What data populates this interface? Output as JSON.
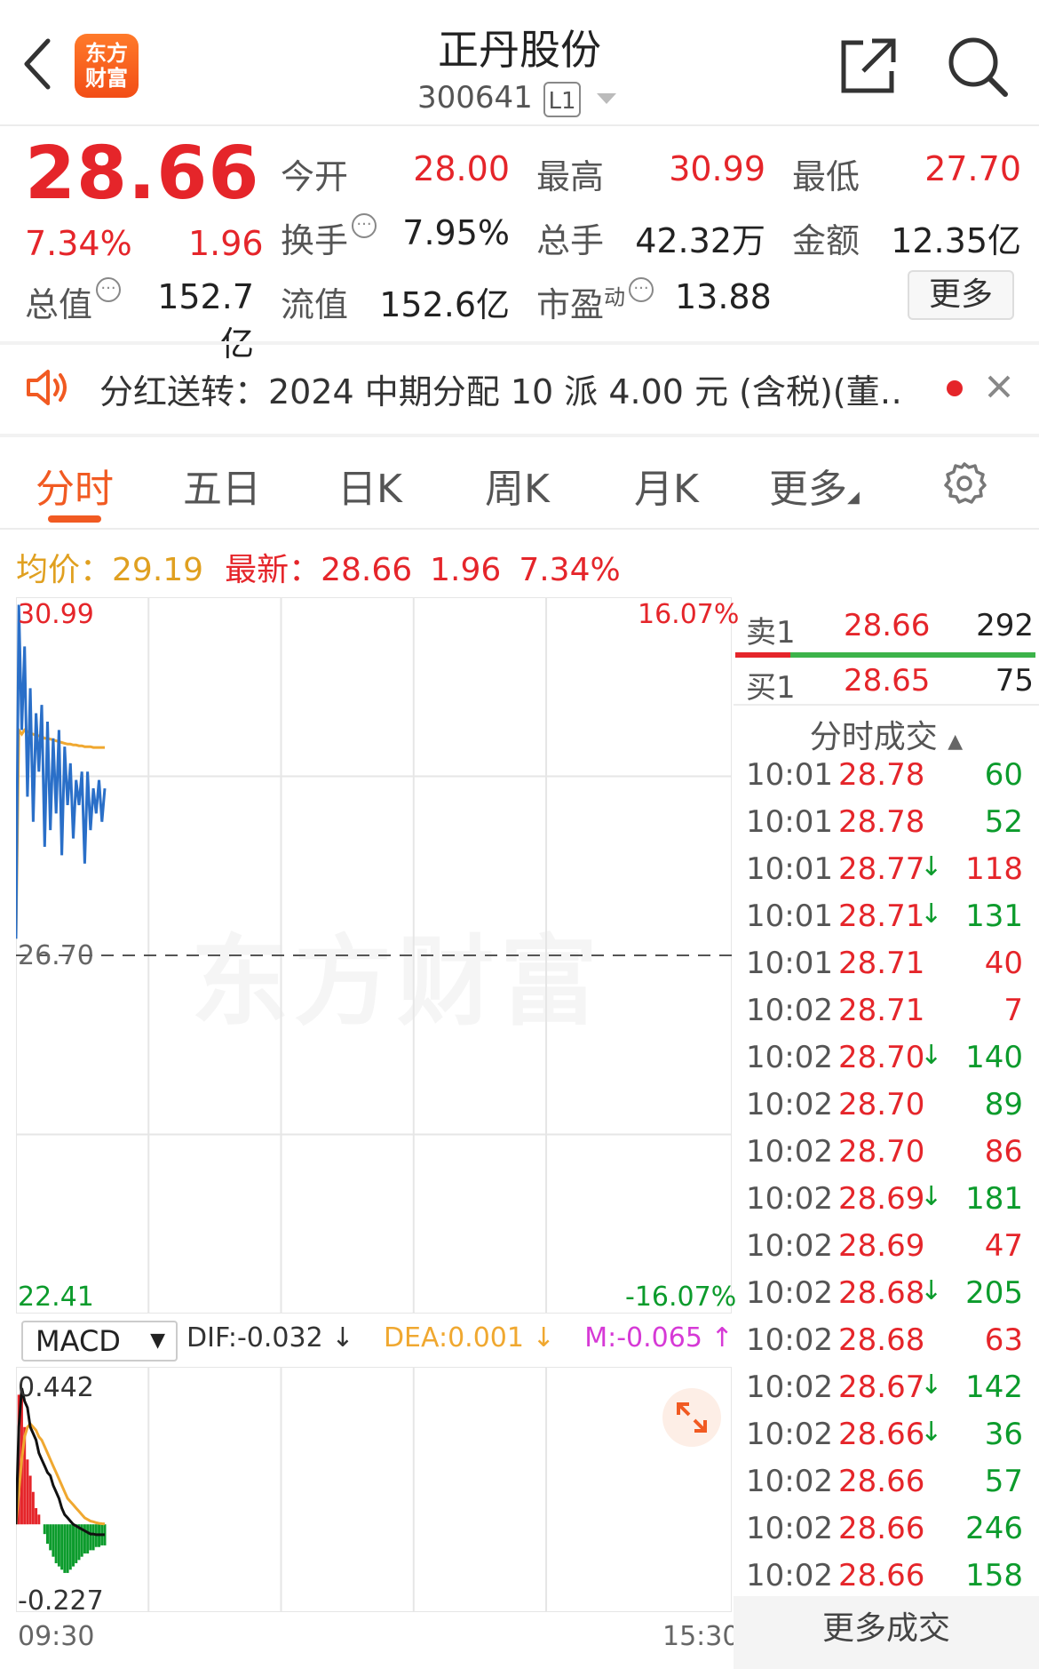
{
  "header": {
    "stock_name": "正丹股份",
    "stock_code": "300641",
    "level": "L1",
    "logo_text_1": "东方",
    "logo_text_2": "财富"
  },
  "quote": {
    "price": "28.66",
    "change_pct": "7.34%",
    "change_abs": "1.96",
    "fields": [
      {
        "label": "今开",
        "value": "28.00"
      },
      {
        "label": "最高",
        "value": "30.99"
      },
      {
        "label": "最低",
        "value": "27.70"
      },
      {
        "label": "换手",
        "value": "7.95%"
      },
      {
        "label": "总手",
        "value": "42.32万"
      },
      {
        "label": "金额",
        "value": "12.35亿"
      },
      {
        "label": "总值",
        "value": "152.7亿"
      },
      {
        "label": "流值",
        "value": "152.6亿"
      },
      {
        "label": "市盈",
        "value": "13.88"
      }
    ],
    "pe_superscript": "动",
    "more_label": "更多"
  },
  "notice": {
    "text": "分红送转：2024 中期分配 10 派 4.00 元 (含税)(董…"
  },
  "tabs": [
    "分时",
    "五日",
    "日K",
    "周K",
    "月K",
    "更多"
  ],
  "summary": {
    "avg_label": "均价：",
    "avg_value": "29.19",
    "latest_label": "最新：",
    "latest_value": "28.66",
    "latest_change": "1.96",
    "latest_pct": "7.34%"
  },
  "chart_data": {
    "type": "line",
    "title": "",
    "x_start": "09:30",
    "x_end": "15:30",
    "ylim": [
      22.41,
      30.99
    ],
    "y_top_label": "30.99",
    "y_bottom_label": "22.41",
    "y_mid_label": "26.70",
    "pct_top_label": "16.07%",
    "pct_bottom_label": "-16.07%",
    "series": [
      {
        "values": [
          26.9,
          30.9,
          29.4,
          30.4,
          28.6,
          29.9,
          28.3,
          29.6,
          28.9,
          29.7,
          28.0,
          29.5,
          28.2,
          29.3,
          28.4,
          29.4,
          27.9,
          29.2,
          28.5,
          29.0,
          28.1,
          28.8,
          28.5,
          28.9,
          27.8,
          28.9,
          28.2,
          28.7,
          28.4,
          28.8,
          28.3,
          28.7
        ]
      },
      {
        "values": [
          26.9,
          29.4,
          29.35,
          29.4,
          29.38,
          29.36,
          29.35,
          29.33,
          29.33,
          29.32,
          29.3,
          29.3,
          29.29,
          29.28,
          29.27,
          29.26,
          29.25,
          29.24,
          29.23,
          29.23,
          29.22,
          29.22,
          29.21,
          29.21,
          29.2,
          29.2,
          29.2,
          29.19,
          29.19,
          29.19,
          29.19,
          29.19
        ]
      }
    ],
    "macd": {
      "selector": "MACD",
      "dif": "DIF:-0.032",
      "dea": "DEA:0.001",
      "m": "M:-0.065",
      "y_top_label": "0.442",
      "y_bottom_label": "-0.227",
      "ylim": [
        -0.227,
        0.442
      ],
      "dif_values": [
        0.0,
        0.3,
        0.42,
        0.38,
        0.36,
        0.3,
        0.28,
        0.26,
        0.22,
        0.2,
        0.18,
        0.16,
        0.15,
        0.12,
        0.1,
        0.08,
        0.05,
        0.03,
        0.02,
        0.01,
        0.0,
        -0.005,
        -0.01,
        -0.015,
        -0.02,
        -0.025,
        -0.03,
        -0.03,
        -0.032,
        -0.032,
        -0.032,
        -0.032
      ],
      "dea_values": [
        0.0,
        0.1,
        0.2,
        0.27,
        0.3,
        0.31,
        0.3,
        0.29,
        0.27,
        0.26,
        0.24,
        0.22,
        0.2,
        0.18,
        0.16,
        0.14,
        0.12,
        0.1,
        0.08,
        0.07,
        0.06,
        0.05,
        0.04,
        0.03,
        0.02,
        0.015,
        0.01,
        0.008,
        0.005,
        0.003,
        0.002,
        0.001
      ],
      "m_values": [
        0.0,
        0.4,
        0.42,
        0.3,
        0.2,
        0.15,
        0.1,
        0.05,
        0.03,
        0.0,
        -0.03,
        -0.06,
        -0.08,
        -0.1,
        -0.12,
        -0.13,
        -0.14,
        -0.15,
        -0.15,
        -0.14,
        -0.13,
        -0.12,
        -0.11,
        -0.1,
        -0.09,
        -0.09,
        -0.08,
        -0.08,
        -0.07,
        -0.07,
        -0.065,
        -0.065
      ]
    }
  },
  "watermark": "东方财富",
  "order_book": {
    "ask": {
      "label": "卖1",
      "price": "28.66",
      "qty": "292"
    },
    "bid": {
      "label": "买1",
      "price": "28.65",
      "qty": "75"
    }
  },
  "ticks_title": "分时成交",
  "ticks": [
    {
      "time": "10:01",
      "price": "28.78",
      "arrow": "",
      "vol": "60",
      "color": "green"
    },
    {
      "time": "10:01",
      "price": "28.78",
      "arrow": "",
      "vol": "52",
      "color": "green"
    },
    {
      "time": "10:01",
      "price": "28.77",
      "arrow": "↓",
      "vol": "118",
      "color": "red"
    },
    {
      "time": "10:01",
      "price": "28.71",
      "arrow": "↓",
      "vol": "131",
      "color": "green"
    },
    {
      "time": "10:01",
      "price": "28.71",
      "arrow": "",
      "vol": "40",
      "color": "red"
    },
    {
      "time": "10:02",
      "price": "28.71",
      "arrow": "",
      "vol": "7",
      "color": "red"
    },
    {
      "time": "10:02",
      "price": "28.70",
      "arrow": "↓",
      "vol": "140",
      "color": "green"
    },
    {
      "time": "10:02",
      "price": "28.70",
      "arrow": "",
      "vol": "89",
      "color": "green"
    },
    {
      "time": "10:02",
      "price": "28.70",
      "arrow": "",
      "vol": "86",
      "color": "red"
    },
    {
      "time": "10:02",
      "price": "28.69",
      "arrow": "↓",
      "vol": "181",
      "color": "green"
    },
    {
      "time": "10:02",
      "price": "28.69",
      "arrow": "",
      "vol": "47",
      "color": "red"
    },
    {
      "time": "10:02",
      "price": "28.68",
      "arrow": "↓",
      "vol": "205",
      "color": "green"
    },
    {
      "time": "10:02",
      "price": "28.68",
      "arrow": "",
      "vol": "63",
      "color": "red"
    },
    {
      "time": "10:02",
      "price": "28.67",
      "arrow": "↓",
      "vol": "142",
      "color": "green"
    },
    {
      "time": "10:02",
      "price": "28.66",
      "arrow": "↓",
      "vol": "36",
      "color": "green"
    },
    {
      "time": "10:02",
      "price": "28.66",
      "arrow": "",
      "vol": "57",
      "color": "green"
    },
    {
      "time": "10:02",
      "price": "28.66",
      "arrow": "",
      "vol": "246",
      "color": "green"
    },
    {
      "time": "10:02",
      "price": "28.66",
      "arrow": "",
      "vol": "158",
      "color": "green"
    }
  ],
  "more_ticks_label": "更多成交",
  "colors": {
    "up": "#e5252a",
    "down": "#0c9b2c",
    "accent": "#f15a22",
    "price_line": "#2a6fc8",
    "avg_line": "#f0a830"
  }
}
